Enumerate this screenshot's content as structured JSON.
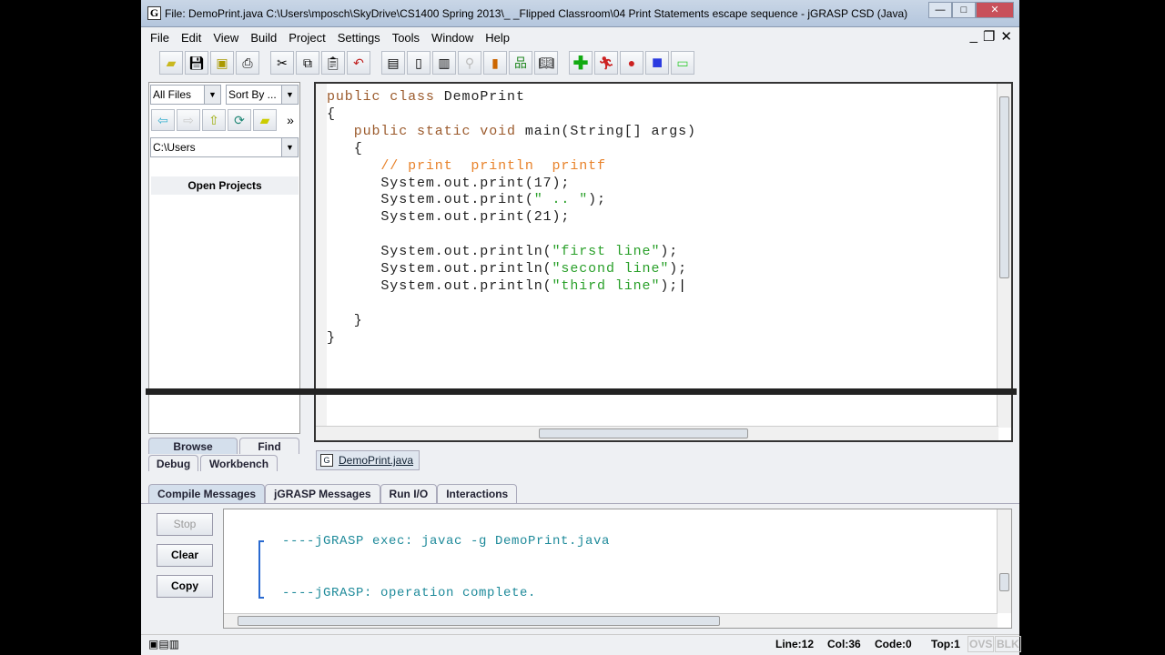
{
  "window": {
    "title": "File: DemoPrint.java  C:\\Users\\mposch\\SkyDrive\\CS1400 Spring 2013\\_ _Flipped Classroom\\04 Print Statements  escape sequence - jGRASP CSD (Java)",
    "app_icon": "G"
  },
  "menu": [
    "File",
    "Edit",
    "View",
    "Build",
    "Project",
    "Settings",
    "Tools",
    "Window",
    "Help"
  ],
  "browser": {
    "filter": "All Files",
    "sort": "Sort By ...",
    "path": "C:\\Users",
    "open_projects": "Open Projects",
    "tabs": {
      "browse": "Browse",
      "find": "Find",
      "debug": "Debug",
      "workbench": "Workbench"
    }
  },
  "editor": {
    "lines": [
      {
        "indent": 0,
        "parts": [
          {
            "c": "kw",
            "t": "public class "
          },
          {
            "c": "",
            "t": "DemoPrint"
          }
        ]
      },
      {
        "indent": 0,
        "parts": [
          {
            "c": "",
            "t": "{"
          }
        ]
      },
      {
        "indent": 3,
        "parts": [
          {
            "c": "kw",
            "t": "public static void "
          },
          {
            "c": "",
            "t": "main(String[] args)"
          }
        ]
      },
      {
        "indent": 3,
        "parts": [
          {
            "c": "",
            "t": "{"
          }
        ]
      },
      {
        "indent": 6,
        "parts": [
          {
            "c": "cm",
            "t": "// print  println  printf"
          }
        ]
      },
      {
        "indent": 6,
        "parts": [
          {
            "c": "",
            "t": "System.out.print(17);"
          }
        ]
      },
      {
        "indent": 6,
        "parts": [
          {
            "c": "",
            "t": "System.out.print("
          },
          {
            "c": "st",
            "t": "\" .. \""
          },
          {
            "c": "",
            "t": ");"
          }
        ]
      },
      {
        "indent": 6,
        "parts": [
          {
            "c": "",
            "t": "System.out.print(21);"
          }
        ]
      },
      {
        "indent": 6,
        "parts": []
      },
      {
        "indent": 6,
        "parts": [
          {
            "c": "",
            "t": "System.out.println("
          },
          {
            "c": "st",
            "t": "\"first line\""
          },
          {
            "c": "",
            "t": ");"
          }
        ]
      },
      {
        "indent": 6,
        "parts": [
          {
            "c": "",
            "t": "System.out.println("
          },
          {
            "c": "st",
            "t": "\"second line\""
          },
          {
            "c": "",
            "t": ");"
          }
        ]
      },
      {
        "indent": 6,
        "parts": [
          {
            "c": "",
            "t": "System.out.println("
          },
          {
            "c": "st",
            "t": "\"third line\""
          },
          {
            "c": "",
            "t": ");"
          }
        ]
      },
      {
        "indent": 6,
        "parts": []
      },
      {
        "indent": 3,
        "parts": [
          {
            "c": "",
            "t": "}"
          }
        ]
      },
      {
        "indent": 0,
        "parts": [
          {
            "c": "",
            "t": "}"
          }
        ]
      }
    ],
    "file_tab": "DemoPrint.java"
  },
  "messages": {
    "tabs": [
      "Compile Messages",
      "jGRASP Messages",
      "Run I/O",
      "Interactions"
    ],
    "stop": "Stop",
    "clear": "Clear",
    "copy": "Copy",
    "lines": [
      "----jGRASP exec: javac -g DemoPrint.java",
      "----jGRASP: operation complete."
    ]
  },
  "status": {
    "line": "Line:12",
    "col": "Col:36",
    "code": "Code:0",
    "top": "Top:1",
    "ovs": "OVS",
    "blk": "BLK"
  }
}
